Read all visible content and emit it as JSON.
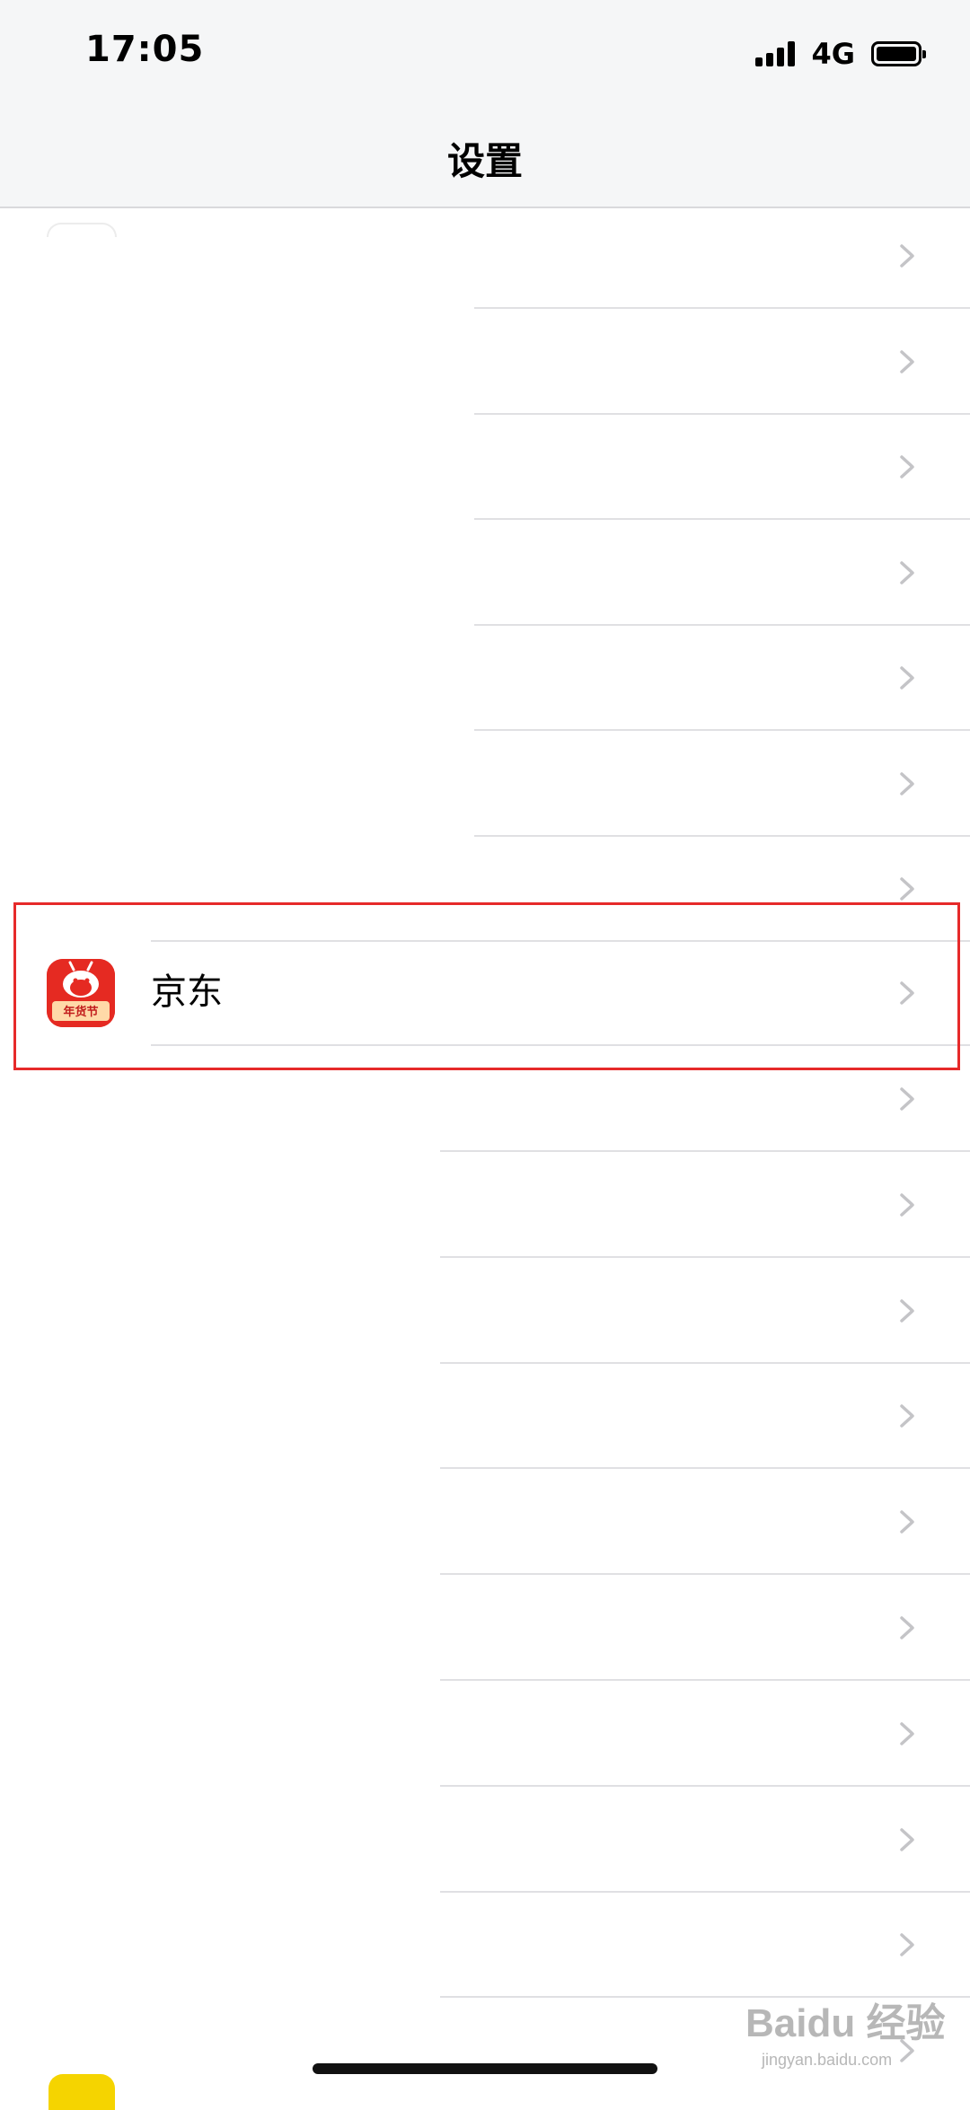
{
  "status_bar": {
    "time": "17:05",
    "network": "4G",
    "icons": [
      "signal-icon",
      "battery-icon"
    ]
  },
  "header": {
    "title": "设置"
  },
  "rows_above": [
    {
      "chevron": "chevron-right-icon"
    },
    {
      "chevron": "chevron-right-icon"
    },
    {
      "chevron": "chevron-right-icon"
    },
    {
      "chevron": "chevron-right-icon"
    },
    {
      "chevron": "chevron-right-icon"
    },
    {
      "chevron": "chevron-right-icon"
    },
    {
      "chevron": "chevron-right-icon"
    }
  ],
  "highlighted_row": {
    "app_name": "京东",
    "icon_text": "年货节",
    "icon": "jd-app-icon",
    "chevron": "chevron-right-icon",
    "highlight_color": "#e62a2a"
  },
  "rows_below": [
    {
      "chevron": "chevron-right-icon"
    },
    {
      "chevron": "chevron-right-icon"
    },
    {
      "chevron": "chevron-right-icon"
    },
    {
      "chevron": "chevron-right-icon"
    },
    {
      "chevron": "chevron-right-icon"
    },
    {
      "chevron": "chevron-right-icon"
    },
    {
      "chevron": "chevron-right-icon"
    },
    {
      "chevron": "chevron-right-icon"
    },
    {
      "chevron": "chevron-right-icon"
    },
    {
      "chevron": "chevron-right-icon"
    }
  ],
  "watermark": {
    "logo_text": "Baidu 经验",
    "sub_text": "jingyan.baidu.com"
  },
  "colors": {
    "header_bg": "#f5f6f7",
    "separator": "#e0e0e3",
    "chevron": "#c4c4c7",
    "jd_red": "#e52a22"
  }
}
